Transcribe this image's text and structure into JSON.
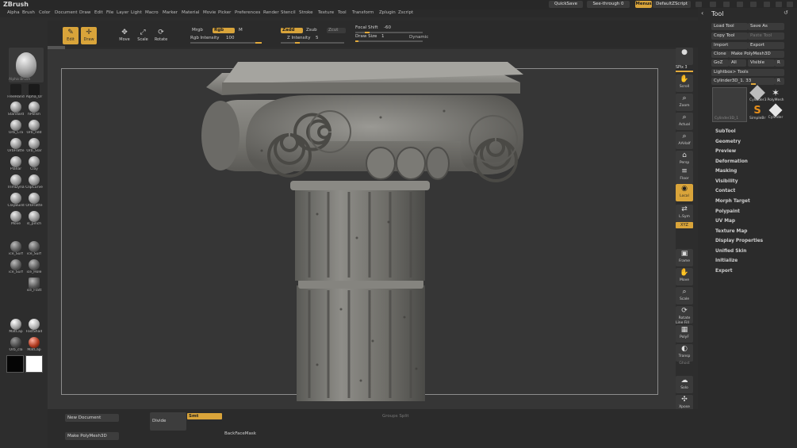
{
  "app": {
    "title": "ZBrush"
  },
  "menus": [
    "Alpha",
    "Brush",
    "Color",
    "Document",
    "Draw",
    "Edit",
    "File",
    "Layer",
    "Light",
    "Macro",
    "Marker",
    "Material",
    "Movie",
    "Picker",
    "Preferences",
    "Render",
    "Stencil",
    "Stroke",
    "Texture",
    "Tool",
    "Transform",
    "Zplugin",
    "Zscript"
  ],
  "topbar": {
    "quicksave": "QuickSave",
    "see_through": "See-through",
    "see_through_value": "0",
    "menus": "Menus",
    "script": "DefaultZScript"
  },
  "shelf": {
    "edit": "Edit",
    "draw": "Draw",
    "move": "Move",
    "scale": "Scale",
    "rotate": "Rotate",
    "mrgb": "Mrgb",
    "rgb": "Rgb",
    "m": "M",
    "rgb_intensity_label": "Rgb Intensity",
    "rgb_intensity_value": "100",
    "zadd": "Zadd",
    "zsub": "Zsub",
    "zcut": "Zcut",
    "z_intensity_label": "Z Intensity",
    "z_intensity_value": "5",
    "focal_shift_label": "Focal Shift",
    "focal_shift_value": "-60",
    "draw_size_label": "Draw Size",
    "draw_size_value": "1",
    "dynamic": "Dynamic"
  },
  "left_tray": {
    "current_brush": "Alpha Brush",
    "brushes": [
      "FreeHand",
      "Alpha_Or",
      "Standard",
      "hPolish",
      "Orb_Cra",
      "Orb_ndd",
      "OrbFlatte",
      "Orb_Slar",
      "Planar",
      "Clay",
      "TrimDyna",
      "ClipCurve",
      "ClayBuild",
      "OrbFlatte",
      "Move",
      "sl_pinch",
      "ice_Surf",
      "ice_Surf",
      "ice_Surf",
      "ice_Hole",
      "ice_Flatt",
      "MatCap",
      "FastShad",
      "Orb_cla",
      "MatCap"
    ]
  },
  "right_shelf": [
    "SPix 3",
    "Scroll",
    "Zoom",
    "Actual",
    "AAHalf",
    "Persp",
    "Floor",
    "Local",
    "L.Sym",
    "XYZ",
    "Frame",
    "Move",
    "Scale",
    "Rotate",
    "Line Fill",
    "PolyF",
    "Transp",
    "Ghost",
    "Solo",
    "Xpose"
  ],
  "tool": {
    "title": "Tool",
    "buttons": {
      "load": "Load Tool",
      "save_as": "Save As",
      "copy": "Copy Tool",
      "paste": "Paste Tool",
      "import": "Import",
      "export": "Export",
      "clone": "Clone",
      "make_polymesh": "Make PolyMesh3D",
      "goz": "GoZ",
      "all": "All",
      "visible": "Visible",
      "r": "R",
      "lightbox": "Lightbox> Tools"
    },
    "current": "Cylinder3D_1. 33",
    "current_r": "R",
    "thumbs": [
      "Cylinder3",
      "PolyMesh",
      "SimpleBr",
      "Cylinder"
    ],
    "thumb_caption": "Cylinder3D_1",
    "subpalettes": [
      "SubTool",
      "Geometry",
      "Preview",
      "Deformation",
      "Masking",
      "Visibility",
      "Contact",
      "Morph Target",
      "Polypaint",
      "UV Map",
      "Texture Map",
      "Display Properties",
      "Unified Skin",
      "Initialize",
      "Export"
    ]
  },
  "bottom": {
    "new_document": "New Document",
    "make_polymesh": "Make PolyMesh3D",
    "divide": "Divide",
    "smt": "Smt",
    "backface": "BackFaceMask",
    "groups_split": "Groups Split"
  },
  "colors": {
    "accent": "#d9a43a",
    "background": "#2d2d2d",
    "canvas": "#363636"
  }
}
